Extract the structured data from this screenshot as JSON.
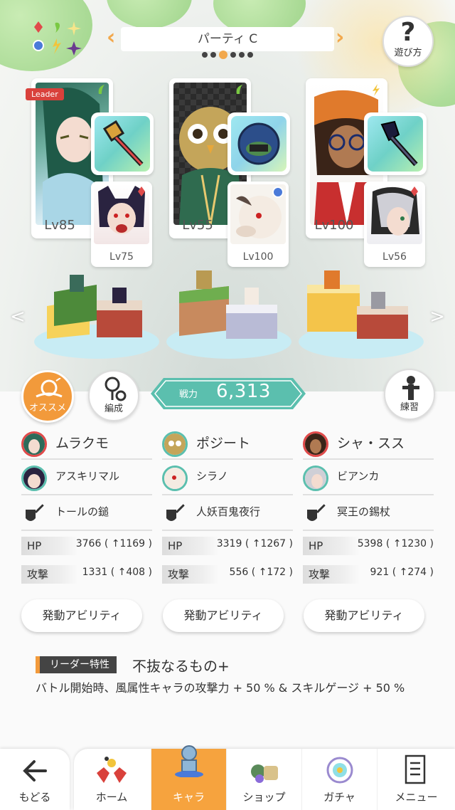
{
  "header": {
    "party_name": "パーティ C",
    "party_dots": [
      false,
      false,
      true,
      false,
      false,
      false
    ],
    "help_label": "遊び方"
  },
  "leader_badge": "Leader",
  "party": [
    {
      "char": "ムラクモ",
      "level": "Lv85",
      "support": "アスキリマル",
      "support_level": "Lv75",
      "weapon": "トールの鎚",
      "hp_label": "HP",
      "hp": "3766 ( ↑1169 )",
      "atk_label": "攻撃",
      "atk": "1331 ( ↑408 )",
      "ability": "発動アビリティ"
    },
    {
      "char": "ポジート",
      "level": "Lv55",
      "support": "シラノ",
      "support_level": "Lv100",
      "weapon": "人妖百鬼夜行",
      "hp_label": "HP",
      "hp": "3319 ( ↑1267 )",
      "atk_label": "攻撃",
      "atk": "556 ( ↑172 )",
      "ability": "発動アビリティ"
    },
    {
      "char": "シャ・スス",
      "level": "Lv100",
      "support": "ビアンカ",
      "support_level": "Lv56",
      "weapon": "冥王の錫杖",
      "hp_label": "HP",
      "hp": "5398 ( ↑1230 )",
      "atk_label": "攻撃",
      "atk": "921 ( ↑274 )",
      "ability": "発動アビリティ"
    }
  ],
  "buttons": {
    "recommend": "オススメ",
    "formation": "編成",
    "practice": "練習"
  },
  "power": {
    "label": "戦力",
    "value": "6,313"
  },
  "leader_skill": {
    "tag": "リーダー特性",
    "name": "不抜なるもの+",
    "desc": "バトル開始時、風属性キャラの攻撃力 + 50 % & スキルゲージ + 50 %"
  },
  "tabbar": {
    "back": "もどる",
    "home": "ホーム",
    "chara": "キャラ",
    "shop": "ショップ",
    "gacha": "ガチャ",
    "menu": "メニュー"
  },
  "colors": {
    "accent": "#f29a3b",
    "teal": "#5bbfae",
    "red": "#e04a4a"
  }
}
